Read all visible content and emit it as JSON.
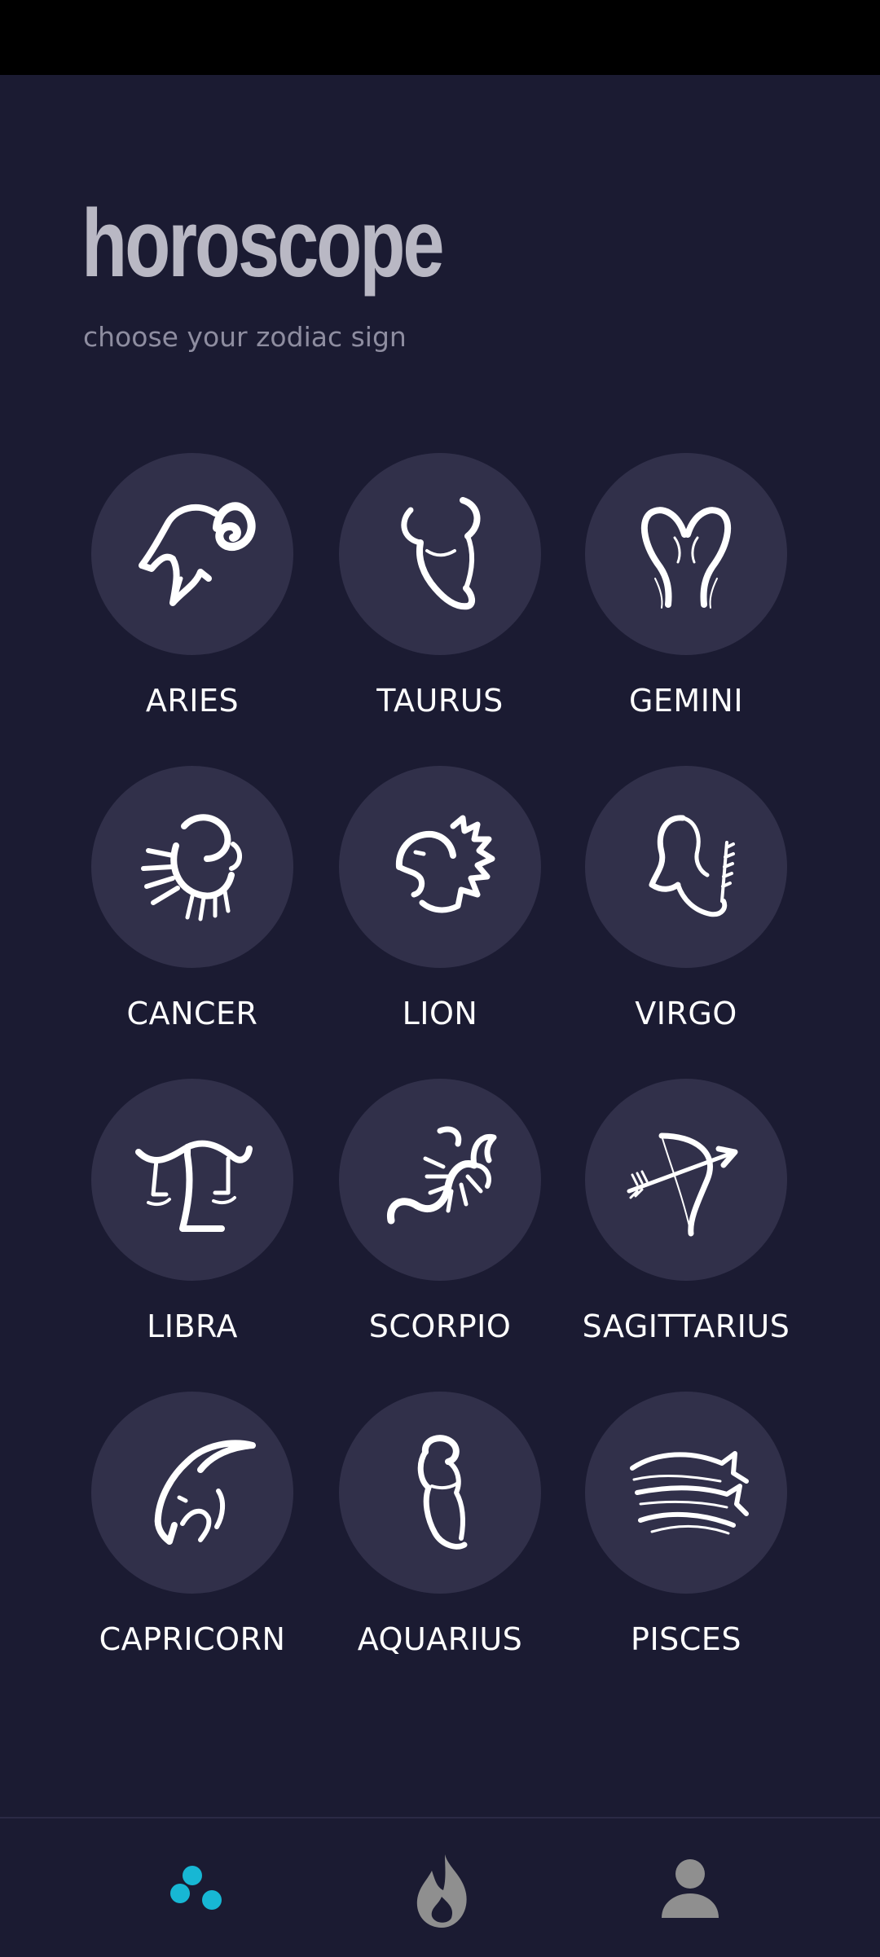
{
  "header": {
    "title": "horoscope",
    "subtitle": "choose your zodiac sign"
  },
  "signs": [
    {
      "label": "ARIES",
      "icon": "ram-icon"
    },
    {
      "label": "TAURUS",
      "icon": "bull-icon"
    },
    {
      "label": "GEMINI",
      "icon": "twins-icon"
    },
    {
      "label": "CANCER",
      "icon": "crab-icon"
    },
    {
      "label": "LION",
      "icon": "lion-icon"
    },
    {
      "label": "VIRGO",
      "icon": "maiden-icon"
    },
    {
      "label": "LIBRA",
      "icon": "scales-icon"
    },
    {
      "label": "SCORPIO",
      "icon": "scorpion-icon"
    },
    {
      "label": "SAGITTARIUS",
      "icon": "archer-bow-icon"
    },
    {
      "label": "CAPRICORN",
      "icon": "goat-icon"
    },
    {
      "label": "AQUARIUS",
      "icon": "water-bearer-icon"
    },
    {
      "label": "PISCES",
      "icon": "fish-icon"
    }
  ],
  "bottom_nav": {
    "items": [
      {
        "name": "signs",
        "icon": "dots-icon",
        "active": true
      },
      {
        "name": "trending",
        "icon": "flame-icon",
        "active": false
      },
      {
        "name": "profile",
        "icon": "person-icon",
        "active": false
      }
    ]
  },
  "colors": {
    "background": "#1b1b32",
    "circle": "#31304a",
    "title": "#b9b8c4",
    "subtitle": "#8e8da0",
    "label": "#ffffff",
    "nav_active": "#17b7d4",
    "nav_inactive": "#8f8f8f"
  }
}
